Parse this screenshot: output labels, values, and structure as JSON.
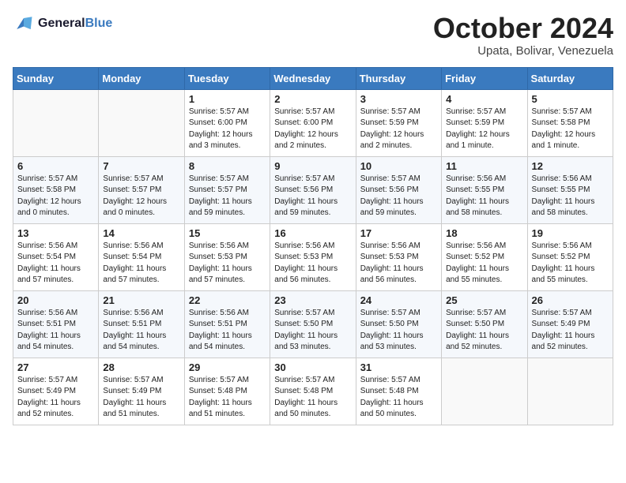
{
  "header": {
    "logo_line1": "General",
    "logo_line2": "Blue",
    "month_title": "October 2024",
    "location": "Upata, Bolivar, Venezuela"
  },
  "weekdays": [
    "Sunday",
    "Monday",
    "Tuesday",
    "Wednesday",
    "Thursday",
    "Friday",
    "Saturday"
  ],
  "weeks": [
    [
      {
        "day": null,
        "info": ""
      },
      {
        "day": null,
        "info": ""
      },
      {
        "day": "1",
        "info": "Sunrise: 5:57 AM\nSunset: 6:00 PM\nDaylight: 12 hours\nand 3 minutes."
      },
      {
        "day": "2",
        "info": "Sunrise: 5:57 AM\nSunset: 6:00 PM\nDaylight: 12 hours\nand 2 minutes."
      },
      {
        "day": "3",
        "info": "Sunrise: 5:57 AM\nSunset: 5:59 PM\nDaylight: 12 hours\nand 2 minutes."
      },
      {
        "day": "4",
        "info": "Sunrise: 5:57 AM\nSunset: 5:59 PM\nDaylight: 12 hours\nand 1 minute."
      },
      {
        "day": "5",
        "info": "Sunrise: 5:57 AM\nSunset: 5:58 PM\nDaylight: 12 hours\nand 1 minute."
      }
    ],
    [
      {
        "day": "6",
        "info": "Sunrise: 5:57 AM\nSunset: 5:58 PM\nDaylight: 12 hours\nand 0 minutes."
      },
      {
        "day": "7",
        "info": "Sunrise: 5:57 AM\nSunset: 5:57 PM\nDaylight: 12 hours\nand 0 minutes."
      },
      {
        "day": "8",
        "info": "Sunrise: 5:57 AM\nSunset: 5:57 PM\nDaylight: 11 hours\nand 59 minutes."
      },
      {
        "day": "9",
        "info": "Sunrise: 5:57 AM\nSunset: 5:56 PM\nDaylight: 11 hours\nand 59 minutes."
      },
      {
        "day": "10",
        "info": "Sunrise: 5:57 AM\nSunset: 5:56 PM\nDaylight: 11 hours\nand 59 minutes."
      },
      {
        "day": "11",
        "info": "Sunrise: 5:56 AM\nSunset: 5:55 PM\nDaylight: 11 hours\nand 58 minutes."
      },
      {
        "day": "12",
        "info": "Sunrise: 5:56 AM\nSunset: 5:55 PM\nDaylight: 11 hours\nand 58 minutes."
      }
    ],
    [
      {
        "day": "13",
        "info": "Sunrise: 5:56 AM\nSunset: 5:54 PM\nDaylight: 11 hours\nand 57 minutes."
      },
      {
        "day": "14",
        "info": "Sunrise: 5:56 AM\nSunset: 5:54 PM\nDaylight: 11 hours\nand 57 minutes."
      },
      {
        "day": "15",
        "info": "Sunrise: 5:56 AM\nSunset: 5:53 PM\nDaylight: 11 hours\nand 57 minutes."
      },
      {
        "day": "16",
        "info": "Sunrise: 5:56 AM\nSunset: 5:53 PM\nDaylight: 11 hours\nand 56 minutes."
      },
      {
        "day": "17",
        "info": "Sunrise: 5:56 AM\nSunset: 5:53 PM\nDaylight: 11 hours\nand 56 minutes."
      },
      {
        "day": "18",
        "info": "Sunrise: 5:56 AM\nSunset: 5:52 PM\nDaylight: 11 hours\nand 55 minutes."
      },
      {
        "day": "19",
        "info": "Sunrise: 5:56 AM\nSunset: 5:52 PM\nDaylight: 11 hours\nand 55 minutes."
      }
    ],
    [
      {
        "day": "20",
        "info": "Sunrise: 5:56 AM\nSunset: 5:51 PM\nDaylight: 11 hours\nand 54 minutes."
      },
      {
        "day": "21",
        "info": "Sunrise: 5:56 AM\nSunset: 5:51 PM\nDaylight: 11 hours\nand 54 minutes."
      },
      {
        "day": "22",
        "info": "Sunrise: 5:56 AM\nSunset: 5:51 PM\nDaylight: 11 hours\nand 54 minutes."
      },
      {
        "day": "23",
        "info": "Sunrise: 5:57 AM\nSunset: 5:50 PM\nDaylight: 11 hours\nand 53 minutes."
      },
      {
        "day": "24",
        "info": "Sunrise: 5:57 AM\nSunset: 5:50 PM\nDaylight: 11 hours\nand 53 minutes."
      },
      {
        "day": "25",
        "info": "Sunrise: 5:57 AM\nSunset: 5:50 PM\nDaylight: 11 hours\nand 52 minutes."
      },
      {
        "day": "26",
        "info": "Sunrise: 5:57 AM\nSunset: 5:49 PM\nDaylight: 11 hours\nand 52 minutes."
      }
    ],
    [
      {
        "day": "27",
        "info": "Sunrise: 5:57 AM\nSunset: 5:49 PM\nDaylight: 11 hours\nand 52 minutes."
      },
      {
        "day": "28",
        "info": "Sunrise: 5:57 AM\nSunset: 5:49 PM\nDaylight: 11 hours\nand 51 minutes."
      },
      {
        "day": "29",
        "info": "Sunrise: 5:57 AM\nSunset: 5:48 PM\nDaylight: 11 hours\nand 51 minutes."
      },
      {
        "day": "30",
        "info": "Sunrise: 5:57 AM\nSunset: 5:48 PM\nDaylight: 11 hours\nand 50 minutes."
      },
      {
        "day": "31",
        "info": "Sunrise: 5:57 AM\nSunset: 5:48 PM\nDaylight: 11 hours\nand 50 minutes."
      },
      {
        "day": null,
        "info": ""
      },
      {
        "day": null,
        "info": ""
      }
    ]
  ]
}
